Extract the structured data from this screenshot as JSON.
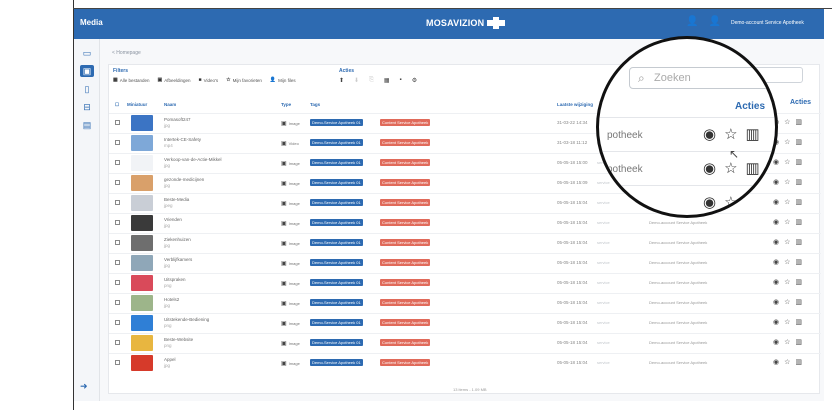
{
  "app": {
    "title": "Media",
    "logo_text": "MOSAVIZION",
    "user_label": "Demo-account Service Apotheek",
    "top_icons": [
      "user-settings-icon",
      "user-icon"
    ]
  },
  "sidebar": {
    "items": [
      {
        "icon": "monitor-icon",
        "glyph": "🖵"
      },
      {
        "icon": "image-icon",
        "glyph": "▣",
        "active": true
      },
      {
        "icon": "tablet-icon",
        "glyph": "▭"
      },
      {
        "icon": "layout-icon",
        "glyph": "⊟"
      },
      {
        "icon": "calendar-icon",
        "glyph": "▤"
      }
    ],
    "logout_icon": "sign-out-icon"
  },
  "breadcrumb": "< Homepage",
  "filters": {
    "title": "Filters",
    "items": [
      {
        "icon": "grid-icon",
        "label": "Alle bestanden"
      },
      {
        "icon": "image-icon",
        "label": "Afbeeldingen"
      },
      {
        "icon": "video-icon",
        "label": "Video's"
      },
      {
        "icon": "star-icon",
        "label": "Mijn favorieten"
      },
      {
        "icon": "user-icon",
        "label": "Mijn files"
      }
    ]
  },
  "acties": {
    "title": "Acties",
    "icons": [
      "upload-icon",
      "download-icon",
      "copy-icon",
      "grid-icon",
      "trash-icon",
      "settings-icon"
    ]
  },
  "search": {
    "placeholder": "Zoeken"
  },
  "table": {
    "headers": {
      "select": "Miniatuur",
      "name": "Naam",
      "type": "Type",
      "tags": "Tags",
      "date": "Laatste wijziging",
      "by": "Laatst gewijzigd door",
      "acties": "Acties"
    },
    "rows": [
      {
        "name": "Pomasoft247",
        "ext": "jpg",
        "type": "Image",
        "tag1": "Demo-Service Apotheek 01",
        "tag2": "Content Service Apotheek",
        "date": "31-03-22 14:34",
        "by": "service",
        "owner": "",
        "thumb": "#3b74c4"
      },
      {
        "name": "Intertek-CE-Safety",
        "ext": "mp4",
        "type": "Video",
        "tag1": "Demo-Service Apotheek 01",
        "tag2": "Content Service Apotheek",
        "date": "31-03-18 11:12",
        "by": "service",
        "owner": "",
        "thumb": "#7ea8d8"
      },
      {
        "name": "Verkoop-van-de-Actie-Mikkel",
        "ext": "jpg",
        "type": "Image",
        "tag1": "Demo-Service Apotheek 01",
        "tag2": "Content Service Apotheek",
        "date": "05-05-18 15:00",
        "by": "service",
        "owner": "",
        "thumb": "#f1f3f6"
      },
      {
        "name": "gezonde-medicijnen",
        "ext": "jpg",
        "type": "Image",
        "tag1": "Demo-Service Apotheek 01",
        "tag2": "Content Service Apotheek",
        "date": "05-05-18 15:09",
        "by": "service",
        "owner": "",
        "thumb": "#d9a06a"
      },
      {
        "name": "Beste-Media",
        "ext": "jpeg",
        "type": "Image",
        "tag1": "Demo-Service Apotheek 01",
        "tag2": "Content Service Apotheek",
        "date": "05-05-18 15:04",
        "by": "service",
        "owner": "Demo-account Service",
        "thumb": "#c9ced6"
      },
      {
        "name": "Vrienden",
        "ext": "jpg",
        "type": "Image",
        "tag1": "Demo-Service Apotheek 01",
        "tag2": "Content Service Apotheek",
        "date": "05-05-18 15:04",
        "by": "service",
        "owner": "Demo-account Service Apotheek",
        "thumb": "#3a3a3a"
      },
      {
        "name": "Ziekenhuizen",
        "ext": "jpg",
        "type": "Image",
        "tag1": "Demo-Service Apotheek 01",
        "tag2": "Content Service Apotheek",
        "date": "05-05-18 15:04",
        "by": "service",
        "owner": "Demo-account Service Apotheek",
        "thumb": "#6e6e6e"
      },
      {
        "name": "Verblijfkamers",
        "ext": "jpg",
        "type": "Image",
        "tag1": "Demo-Service Apotheek 01",
        "tag2": "Content Service Apotheek",
        "date": "05-05-18 15:04",
        "by": "service",
        "owner": "Demo-account Service Apotheek",
        "thumb": "#8fa7b8"
      },
      {
        "name": "Uitspraken",
        "ext": "png",
        "type": "Image",
        "tag1": "Demo-Service Apotheek 01",
        "tag2": "Content Service Apotheek",
        "date": "05-05-18 15:04",
        "by": "service",
        "owner": "Demo-account Service Apotheek",
        "thumb": "#d94a5a"
      },
      {
        "name": "Hotels2",
        "ext": "jpg",
        "type": "Image",
        "tag1": "Demo-Service Apotheek 01",
        "tag2": "Content Service Apotheek",
        "date": "05-05-18 15:04",
        "by": "service",
        "owner": "Demo-account Service Apotheek",
        "thumb": "#9db58a"
      },
      {
        "name": "Uitstekende-Bediening",
        "ext": "png",
        "type": "Image",
        "tag1": "Demo-Service Apotheek 01",
        "tag2": "Content Service Apotheek",
        "date": "05-05-18 15:04",
        "by": "service",
        "owner": "Demo-account Service Apotheek",
        "thumb": "#2f7fd6"
      },
      {
        "name": "Beste-Website",
        "ext": "png",
        "type": "Image",
        "tag1": "Demo-Service Apotheek 01",
        "tag2": "Content Service Apotheek",
        "date": "05-05-18 15:04",
        "by": "service",
        "owner": "Demo-account Service Apotheek",
        "thumb": "#e8b640"
      },
      {
        "name": "Appel",
        "ext": "jpg",
        "type": "Image",
        "tag1": "Demo-Service Apotheek 01",
        "tag2": "Content Service Apotheek",
        "date": "05-05-18 15:04",
        "by": "service",
        "owner": "Demo-account Service Apotheek",
        "thumb": "#d63a2a"
      }
    ],
    "footer": "13 items - 1.09 MB"
  },
  "zoom": {
    "search_placeholder": "Zoeken",
    "acties": "Acties",
    "rows": [
      "potheek",
      "potheek",
      "ek"
    ]
  },
  "colors": {
    "brand": "#2d6ab1",
    "tag_blue": "#2d6ab1",
    "tag_red": "#e06a5a"
  }
}
